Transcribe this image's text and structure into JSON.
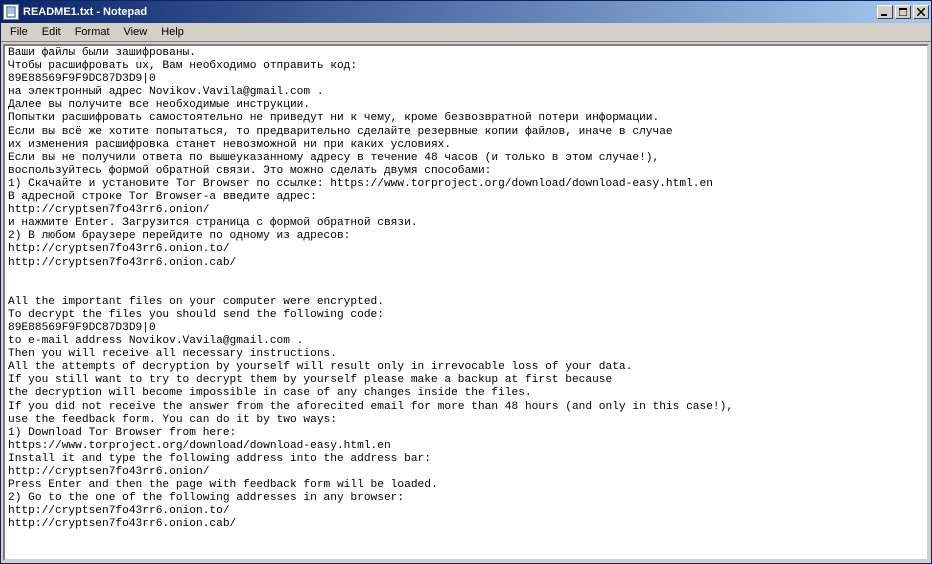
{
  "window": {
    "title": "README1.txt - Notepad"
  },
  "menubar": {
    "file": "File",
    "edit": "Edit",
    "format": "Format",
    "view": "View",
    "help": "Help"
  },
  "content": {
    "text": "Ваши файлы были зашифрованы.\nЧтобы расшифровать ux, Вам необходимо отправить код:\n89E88569F9F9DC87D3D9|0\nна электронный адрес Novikov.Vavila@gmail.com .\nДалее вы получите все необходимые инструкции.\nПопытки расшифровать самостоятельно не приведут ни к чему, кроме безвозвратной потери информации.\nЕсли вы всё же хотите попытаться, то предварительно сделайте резервные копии файлов, иначе в случае\nих изменения расшифровка станет невозможной ни при каких условиях.\nЕсли вы не получили ответа по вышеуказанному адресу в течение 48 часов (и только в этом случае!),\nвоспользуйтесь формой обратной связи. Это можно сделать двумя способами:\n1) Скачайте и установите Tor Browser по ссылке: https://www.torproject.org/download/download-easy.html.en\nВ адресной строке Tor Browser-а введите адрес:\nhttp://cryptsen7fo43rr6.onion/\nи нажмите Enter. Загрузится страница с формой обратной связи.\n2) В любом браузере перейдите по одному из адресов:\nhttp://cryptsen7fo43rr6.onion.to/\nhttp://cryptsen7fo43rr6.onion.cab/\n\n\nAll the important files on your computer were encrypted.\nTo decrypt the files you should send the following code:\n89E88569F9F9DC87D3D9|0\nto e-mail address Novikov.Vavila@gmail.com .\nThen you will receive all necessary instructions.\nAll the attempts of decryption by yourself will result only in irrevocable loss of your data.\nIf you still want to try to decrypt them by yourself please make a backup at first because\nthe decryption will become impossible in case of any changes inside the files.\nIf you did not receive the answer from the aforecited email for more than 48 hours (and only in this case!),\nuse the feedback form. You can do it by two ways:\n1) Download Tor Browser from here:\nhttps://www.torproject.org/download/download-easy.html.en\nInstall it and type the following address into the address bar:\nhttp://cryptsen7fo43rr6.onion/\nPress Enter and then the page with feedback form will be loaded.\n2) Go to the one of the following addresses in any browser:\nhttp://cryptsen7fo43rr6.onion.to/\nhttp://cryptsen7fo43rr6.onion.cab/"
  }
}
